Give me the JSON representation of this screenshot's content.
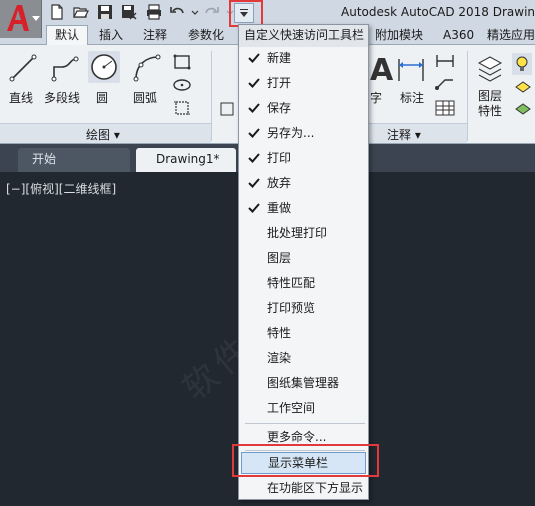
{
  "app_title": "Autodesk AutoCAD 2018    Drawin",
  "quick_access": {
    "icons": [
      "new-icon",
      "open-icon",
      "save-icon",
      "save-as-icon",
      "plot-icon",
      "undo-icon",
      "redo-icon",
      "customize-dropdown-icon"
    ]
  },
  "ribbon_tabs": [
    "默认",
    "插入",
    "注释",
    "参数化",
    "附加模块",
    "A360",
    "精选应用"
  ],
  "ribbon": {
    "draw_tools": [
      "直线",
      "多段线",
      "圆",
      "圆弧"
    ],
    "draw_group_label": "绘图 ▾",
    "right_tools": [
      "字",
      "标注"
    ],
    "annotation_group_label": "注释 ▾",
    "layer_properties": "图层\n特性"
  },
  "doc_tabs": {
    "start": "开始",
    "drawing": "Drawing1*"
  },
  "viewport_label": "[−][俯视][二维线框]",
  "menu": {
    "header": "自定义快速访问工具栏",
    "items": [
      {
        "label": "新建",
        "checked": true
      },
      {
        "label": "打开",
        "checked": true
      },
      {
        "label": "保存",
        "checked": true
      },
      {
        "label": "另存为...",
        "checked": true
      },
      {
        "label": "打印",
        "checked": true
      },
      {
        "label": "放弃",
        "checked": true
      },
      {
        "label": "重做",
        "checked": true
      },
      {
        "label": "批处理打印",
        "checked": false
      },
      {
        "label": "图层",
        "checked": false
      },
      {
        "label": "特性匹配",
        "checked": false
      },
      {
        "label": "打印预览",
        "checked": false
      },
      {
        "label": "特性",
        "checked": false
      },
      {
        "label": "渲染",
        "checked": false
      },
      {
        "label": "图纸集管理器",
        "checked": false
      },
      {
        "label": "工作空间",
        "checked": false
      }
    ],
    "more_commands": "更多命令...",
    "show_menubar": "显示菜单栏",
    "show_below_ribbon": "在功能区下方显示"
  },
  "watermark": "软件自学网"
}
